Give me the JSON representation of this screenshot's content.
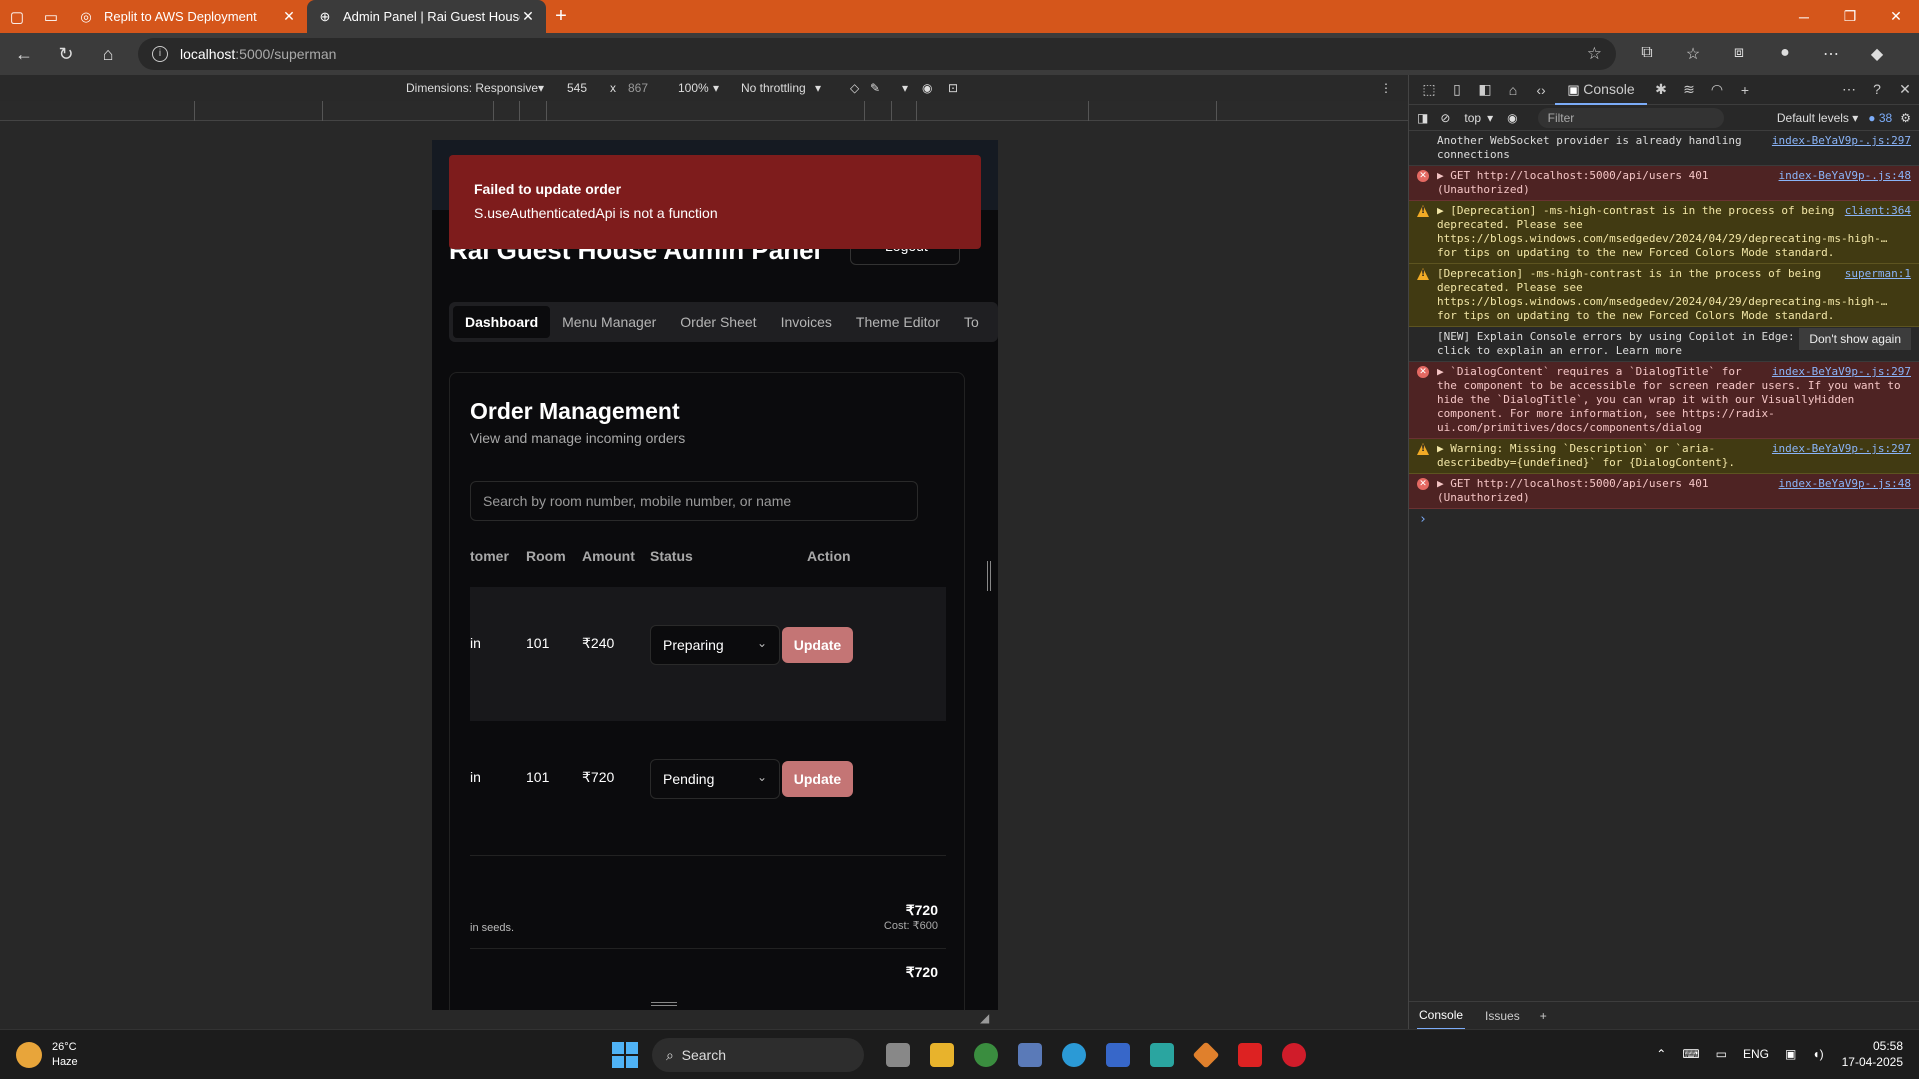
{
  "browser": {
    "tabs": [
      {
        "title": "Replit to AWS Deployment",
        "active": false
      },
      {
        "title": "Admin Panel | Rai Guest House",
        "active": true
      }
    ],
    "url_host": "localhost",
    "url_path": ":5000/superman"
  },
  "device_toolbar": {
    "dimensions_label": "Dimensions: Responsive",
    "width": "545",
    "times": "x",
    "height": "867",
    "zoom": "100%",
    "throttling": "No throttling"
  },
  "app": {
    "toast": {
      "title": "Failed to update order",
      "message": "S.useAuthenticatedApi is not a function"
    },
    "title": "Rai Guest House Admin Panel",
    "logout_label": "Logout",
    "nav_tabs": [
      "Dashboard",
      "Menu Manager",
      "Order Sheet",
      "Invoices",
      "Theme Editor",
      "To"
    ],
    "card_title": "Order Management",
    "card_subtitle": "View and manage incoming orders",
    "search_placeholder": "Search by room number, mobile number, or name",
    "columns": [
      "tomer",
      "Room",
      "Amount",
      "Status",
      "Action"
    ],
    "orders": [
      {
        "customer": "in",
        "room": "101",
        "amount": "₹240",
        "status": "Preparing",
        "action": "Update"
      },
      {
        "customer": "in",
        "room": "101",
        "amount": "₹720",
        "status": "Pending",
        "action": "Update"
      }
    ],
    "summary": [
      {
        "note": "in seeds.",
        "amount": "₹720",
        "cost": "Cost: ₹600"
      },
      {
        "note": "",
        "amount": "₹720",
        "cost": ""
      }
    ]
  },
  "devtools": {
    "active_tab": "Console",
    "context": "top",
    "filter_placeholder": "Filter",
    "levels": "Default levels",
    "issue_count": "38",
    "messages": [
      {
        "type": "info",
        "text": "Another WebSocket provider is already handling connections",
        "src": "index-BeYaV9p-.js:297"
      },
      {
        "type": "error",
        "text": "▶ GET http://localhost:5000/api/users 401 (Unauthorized)",
        "src": "index-BeYaV9p-.js:48"
      },
      {
        "type": "warn",
        "text": "▶ [Deprecation] -ms-high-contrast is in the process of being deprecated. Please see https://blogs.windows.com/msedgedev/2024/04/29/deprecating-ms-high-… for tips on updating to the new Forced Colors Mode standard.",
        "src": "client:364"
      },
      {
        "type": "warn",
        "text": "[Deprecation] -ms-high-contrast is in the process of being deprecated. Please see https://blogs.windows.com/msedgedev/2024/04/29/deprecating-ms-high-… for tips on updating to the new Forced Colors Mode standard.",
        "src": "superman:1"
      },
      {
        "type": "info",
        "text": "[NEW] Explain Console errors by using Copilot in Edge: click to explain an error. Learn more",
        "src": ""
      },
      {
        "type": "error",
        "text": "▶ `DialogContent` requires a `DialogTitle` for the component to be accessible for screen reader users. If you want to hide the `DialogTitle`, you can wrap it with our VisuallyHidden component. For more information, see https://radix-ui.com/primitives/docs/components/dialog",
        "src": "index-BeYaV9p-.js:297"
      },
      {
        "type": "warn",
        "text": "▶ Warning: Missing `Description` or `aria-describedby={undefined}` for {DialogContent}.",
        "src": "index-BeYaV9p-.js:297"
      },
      {
        "type": "error",
        "text": "▶ GET http://localhost:5000/api/users 401 (Unauthorized)",
        "src": "index-BeYaV9p-.js:48"
      }
    ],
    "dont_show_again": "Don't show again",
    "drawer_tabs": [
      "Console",
      "Issues"
    ]
  },
  "taskbar": {
    "temperature": "26°C",
    "condition": "Haze",
    "search_label": "Search",
    "language": "ENG",
    "time": "05:58",
    "date": "17-04-2025"
  }
}
